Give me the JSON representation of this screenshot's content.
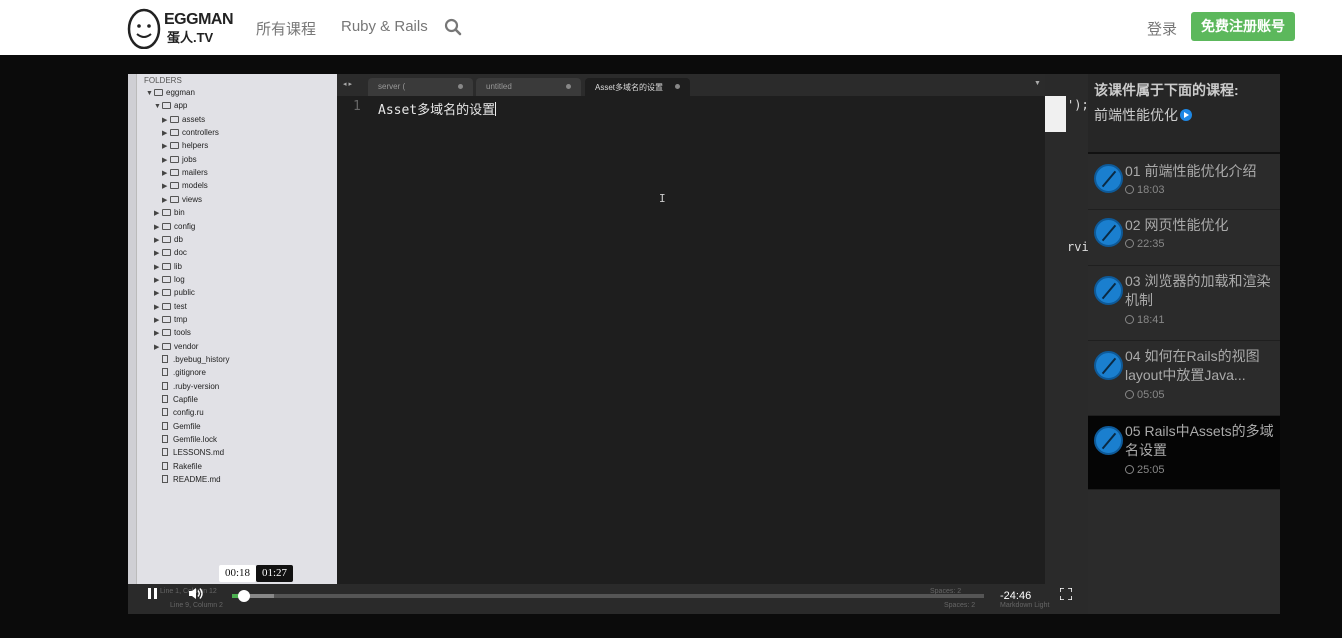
{
  "nav": {
    "brand": "EGGMAN",
    "brand_sub": "蛋人.TV",
    "links": [
      "所有课程",
      "Ruby & Rails"
    ],
    "login": "登录",
    "register": "免费注册账号"
  },
  "editor": {
    "folders_title": "FOLDERS",
    "tree": [
      {
        "label": "eggman",
        "kind": "folder",
        "open": true
      },
      {
        "label": "app",
        "kind": "folder",
        "open": true
      },
      {
        "label": "assets",
        "kind": "folder"
      },
      {
        "label": "controllers",
        "kind": "folder"
      },
      {
        "label": "helpers",
        "kind": "folder"
      },
      {
        "label": "jobs",
        "kind": "folder"
      },
      {
        "label": "mailers",
        "kind": "folder"
      },
      {
        "label": "models",
        "kind": "folder"
      },
      {
        "label": "views",
        "kind": "folder"
      },
      {
        "label": "bin",
        "kind": "folder"
      },
      {
        "label": "config",
        "kind": "folder"
      },
      {
        "label": "db",
        "kind": "folder"
      },
      {
        "label": "doc",
        "kind": "folder"
      },
      {
        "label": "lib",
        "kind": "folder"
      },
      {
        "label": "log",
        "kind": "folder"
      },
      {
        "label": "public",
        "kind": "folder"
      },
      {
        "label": "test",
        "kind": "folder"
      },
      {
        "label": "tmp",
        "kind": "folder"
      },
      {
        "label": "tools",
        "kind": "folder"
      },
      {
        "label": "vendor",
        "kind": "folder"
      },
      {
        "label": ".byebug_history",
        "kind": "file"
      },
      {
        "label": ".gitignore",
        "kind": "file"
      },
      {
        "label": ".ruby-version",
        "kind": "file"
      },
      {
        "label": "Capfile",
        "kind": "file"
      },
      {
        "label": "config.ru",
        "kind": "file"
      },
      {
        "label": "Gemfile",
        "kind": "file"
      },
      {
        "label": "Gemfile.lock",
        "kind": "file"
      },
      {
        "label": "LESSONS.md",
        "kind": "file"
      },
      {
        "label": "Rakefile",
        "kind": "file"
      },
      {
        "label": "README.md",
        "kind": "file"
      }
    ],
    "tabs": [
      "server (",
      "untitled",
      "Asset多域名的设置"
    ],
    "line_number": "1",
    "code": "Asset多域名的设置",
    "side_text_1": "');",
    "side_text_2": "rvi",
    "status_1": "Line 1, Column 12",
    "status_2": "Line 9, Column 2",
    "status_3": "Spaces: 2",
    "status_4": "Spaces: 2",
    "status_5": "Markdown Light"
  },
  "player": {
    "current_time": "00:18",
    "hover_time": "01:27",
    "remaining": "-24:46",
    "progress_fraction": 0.0121,
    "buffered_fraction": 0.056
  },
  "course": {
    "heading": "该课件属于下面的课程:",
    "name": "前端性能优化",
    "lessons": [
      {
        "title": "01 前端性能优化介绍",
        "duration": "18:03",
        "active": false
      },
      {
        "title": "02 网页性能优化",
        "duration": "22:35",
        "active": false
      },
      {
        "title": "03 浏览器的加载和渲染机制",
        "duration": "18:41",
        "active": false
      },
      {
        "title": "04 如何在Rails的视图layout中放置Java...",
        "duration": "05:05",
        "active": false
      },
      {
        "title": "05 Rails中Assets的多域名设置",
        "duration": "25:05",
        "active": true
      }
    ]
  }
}
